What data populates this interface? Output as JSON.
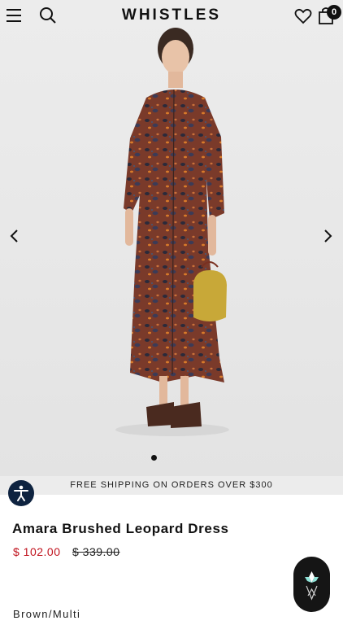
{
  "header": {
    "logo": "WHISTLES",
    "bag_count": "0"
  },
  "hero": {
    "image_alt": "Model wearing brown leopard print shirt dress holding yellow bag",
    "carousel_dots": 1
  },
  "banner": {
    "shipping_text": "FREE SHIPPING ON ORDERS OVER $300"
  },
  "product": {
    "title": "Amara Brushed Leopard Dress",
    "sale_price": "$ 102.00",
    "original_price": "$ 339.00",
    "color": "Brown/Multi"
  },
  "colors": {
    "sale": "#c0121d",
    "a11y_button": "#0e2340",
    "chat_button": "#151515"
  },
  "icons": {
    "menu": "hamburger-icon",
    "search": "search-icon",
    "wishlist": "heart-icon",
    "bag": "shopping-bag-icon",
    "prev": "chevron-left-icon",
    "next": "chevron-right-icon",
    "accessibility": "accessibility-icon",
    "chat": "chat-logo-icon"
  }
}
